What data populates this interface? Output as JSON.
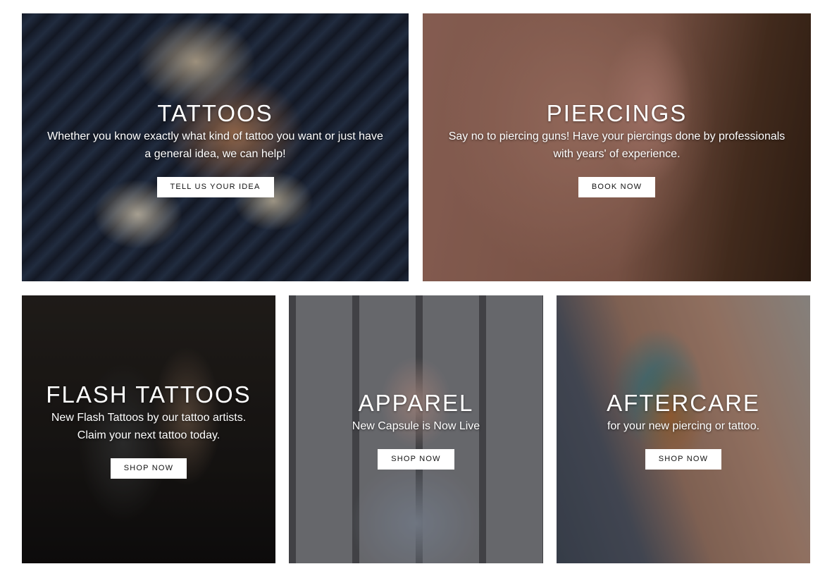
{
  "tiles": [
    {
      "title": "TATTOOS",
      "desc_lines": [
        "Whether you know exactly what kind of tattoo you want or just have",
        "a general idea, we can help!"
      ],
      "button": "TELL US YOUR IDEA"
    },
    {
      "title": "PIERCINGS",
      "desc_lines": [
        "Say no to piercing guns! Have your piercings done by professionals",
        "with years' of experience."
      ],
      "button": "BOOK NOW"
    },
    {
      "title": "FLASH TATTOOS",
      "desc_lines": [
        "New Flash Tattoos by our tattoo artists.",
        "Claim your next tattoo today."
      ],
      "button": "SHOP NOW"
    },
    {
      "title": "APPAREL",
      "desc_lines": [
        "New Capsule is Now Live"
      ],
      "button": "SHOP NOW"
    },
    {
      "title": "AFTERCARE",
      "desc_lines": [
        "for your new piercing or tattoo."
      ],
      "button": "SHOP NOW"
    }
  ]
}
